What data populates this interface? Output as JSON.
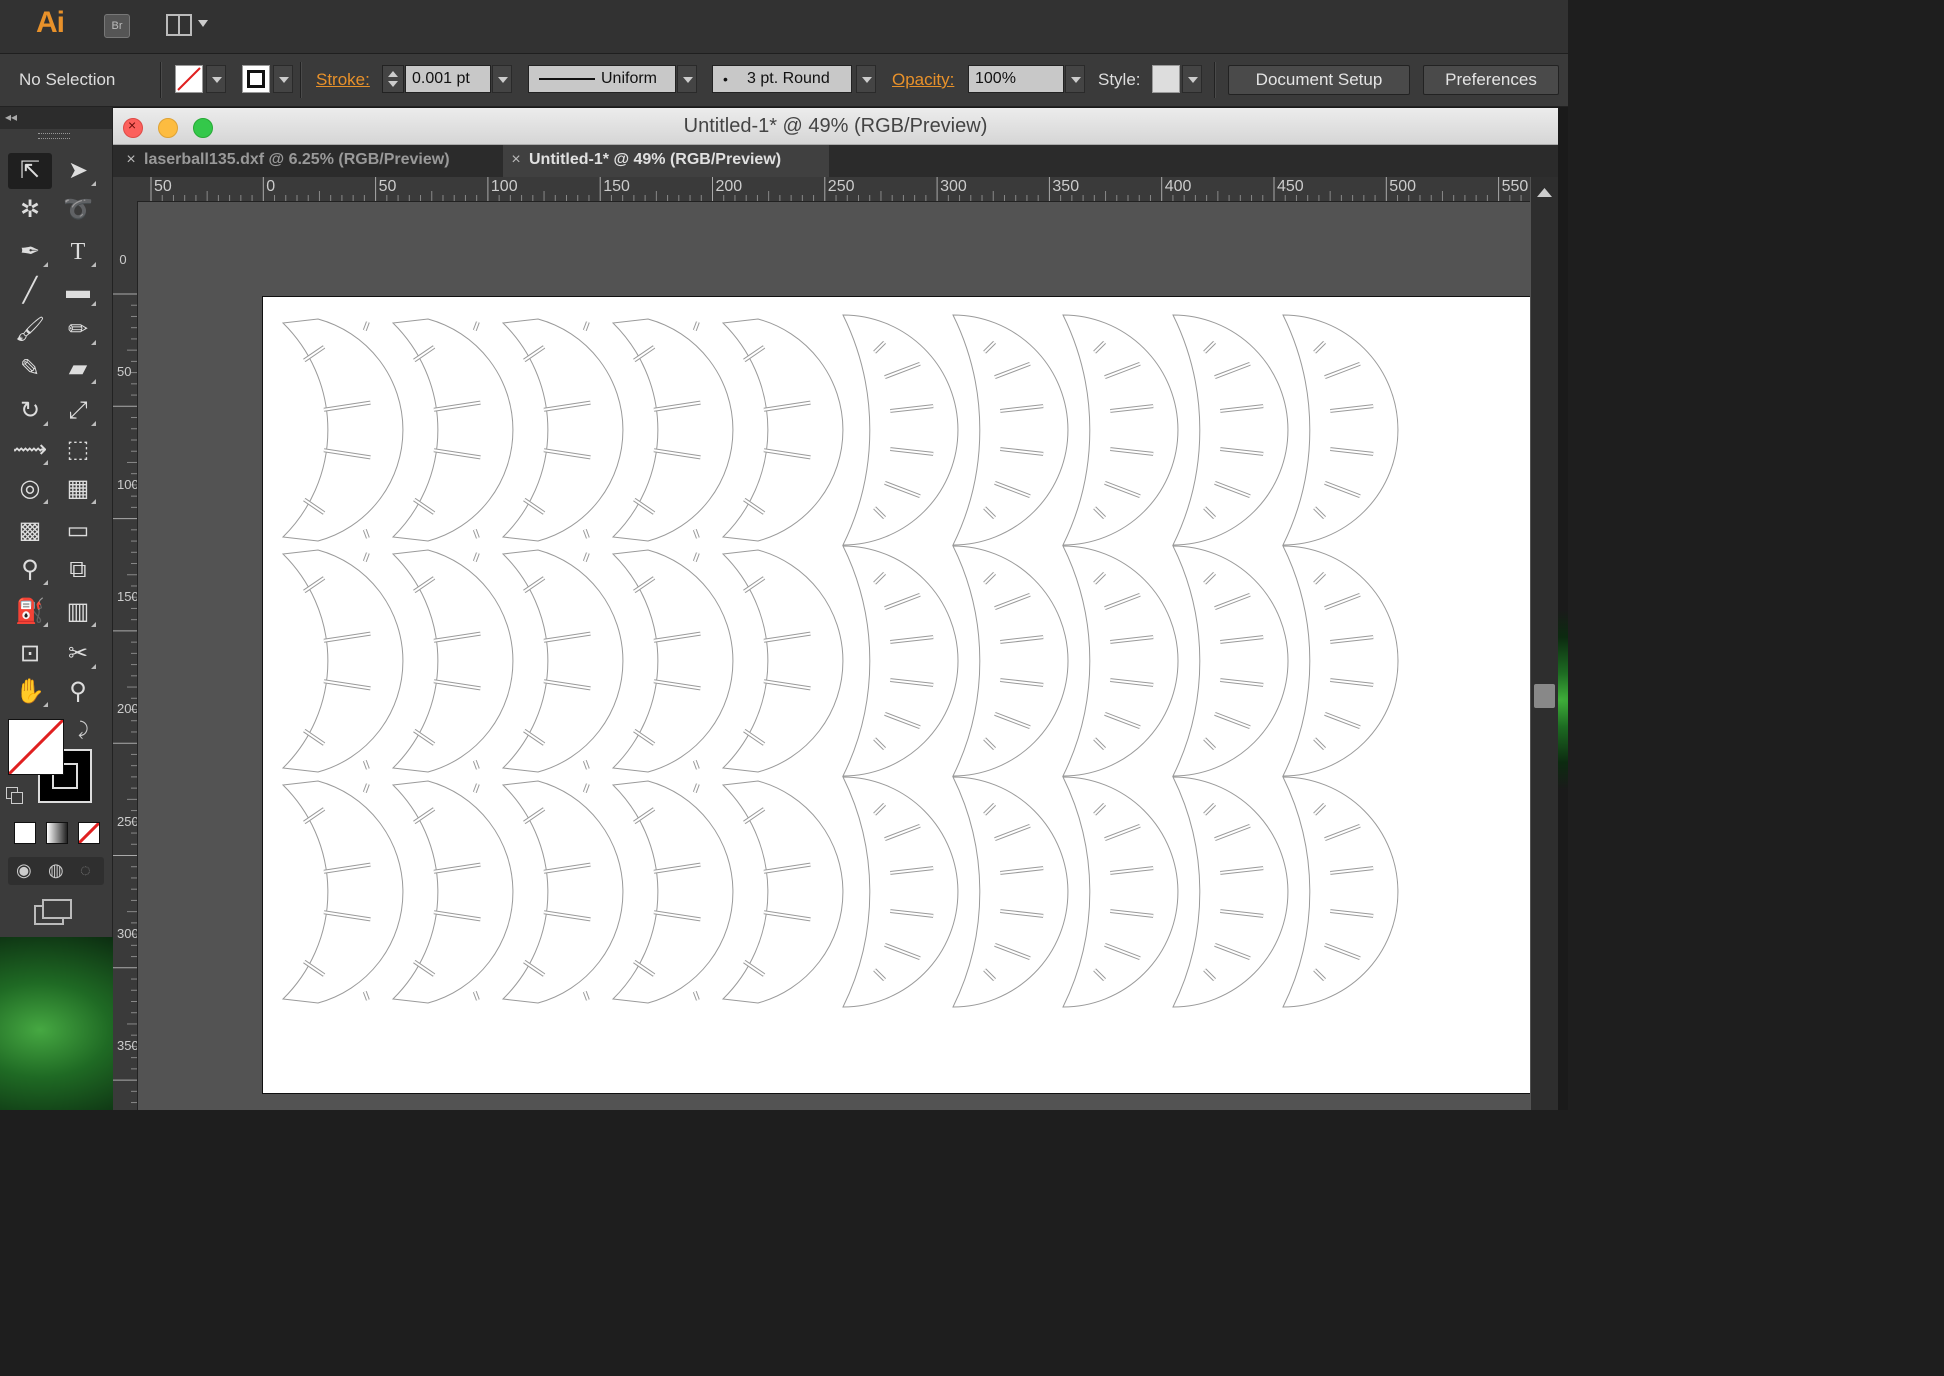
{
  "app": {
    "logo": "Ai",
    "bridge_label": "Br"
  },
  "control_bar": {
    "selection_label": "No Selection",
    "stroke_label": "Stroke:",
    "stroke_value": "0.001 pt",
    "profile_label": "Uniform",
    "brush_label": "3 pt. Round",
    "brush_dot": "•",
    "opacity_label": "Opacity:",
    "opacity_value": "100%",
    "style_label": "Style:",
    "document_setup": "Document Setup",
    "preferences": "Preferences"
  },
  "tools_panel": {
    "collapse_glyph": "◂◂"
  },
  "window": {
    "title": "Untitled-1* @ 49% (RGB/Preview)",
    "tabs": [
      {
        "label": "laserball135.dxf @ 6.25% (RGB/Preview)",
        "close": "×"
      },
      {
        "label": "Untitled-1* @ 49% (RGB/Preview)",
        "close": "×"
      }
    ]
  },
  "rulers": {
    "horizontal": [
      "50",
      "0",
      "50",
      "100",
      "150",
      "200",
      "250",
      "300",
      "350",
      "400",
      "450",
      "500",
      "550"
    ],
    "vertical": [
      "0",
      "50",
      "100",
      "150",
      "200",
      "250",
      "300",
      "350"
    ]
  },
  "colors": {
    "accent": "#e8912a",
    "artboard": "#ffffff",
    "canvas": "#535353"
  }
}
